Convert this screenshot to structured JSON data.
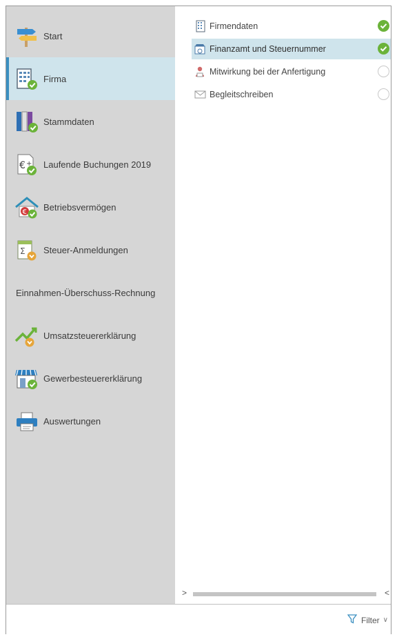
{
  "sidebar": {
    "items": [
      {
        "label": "Start",
        "icon": "signpost-icon"
      },
      {
        "label": "Firma",
        "icon": "building-check-icon",
        "active": true
      },
      {
        "label": "Stammdaten",
        "icon": "binders-check-icon"
      },
      {
        "label": "Laufende Buchungen 2019",
        "icon": "euro-document-check-icon"
      },
      {
        "label": "Betriebsvermögen",
        "icon": "house-euro-check-icon"
      },
      {
        "label": "Steuer-Anmeldungen",
        "icon": "calculator-document-icon"
      },
      {
        "label": "Einnahmen-Überschuss-Rechnung"
      },
      {
        "label": "Umsatzsteuererklärung",
        "icon": "trend-chart-icon"
      },
      {
        "label": "Gewerbesteuererklärung",
        "icon": "shop-check-icon"
      },
      {
        "label": "Auswertungen",
        "icon": "printer-icon"
      }
    ]
  },
  "tasks": [
    {
      "label": "Firmendaten",
      "status": "done"
    },
    {
      "label": "Finanzamt und Steuernummer",
      "status": "done",
      "active": true
    },
    {
      "label": "Mitwirkung bei der Anfertigung",
      "status": "open"
    },
    {
      "label": "Begleitschreiben",
      "status": "open"
    }
  ],
  "scroll": {
    "left": ">",
    "right": "<"
  },
  "footer": {
    "filter_label": "Filter",
    "chevron": "∨"
  },
  "colors": {
    "sidebar_bg": "#d6d6d6",
    "active_bg": "#cfe4ec",
    "accent": "#3b8fc0",
    "done_green": "#6bb33a"
  }
}
